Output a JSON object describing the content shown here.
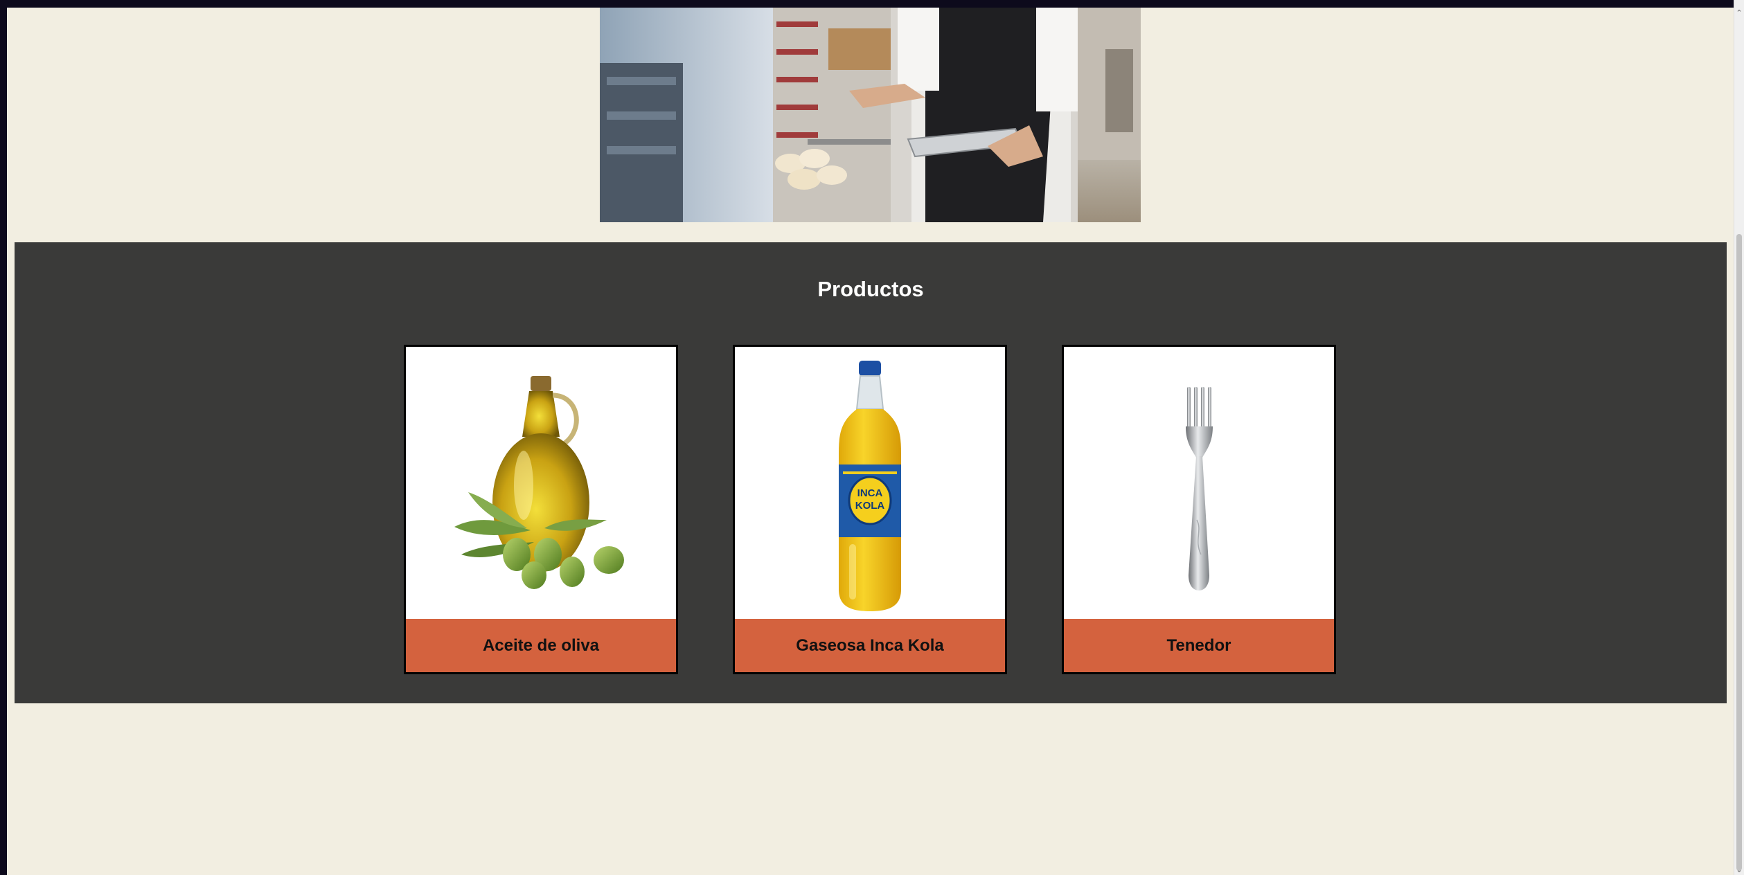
{
  "hero": {
    "alt": "Empleado de panadería con tablet"
  },
  "products_section": {
    "title": "Productos",
    "items": [
      {
        "name": "Aceite de oliva",
        "icon": "olive-oil-image"
      },
      {
        "name": "Gaseosa Inca Kola",
        "icon": "inca-kola-bottle-image",
        "bottle_text": [
          "INCA",
          "KOLA"
        ]
      },
      {
        "name": "Tenedor",
        "icon": "fork-image"
      }
    ]
  },
  "colors": {
    "page_bg": "#f2eee1",
    "section_bg": "#3a3a39",
    "label_bg": "#d4623e",
    "title_color": "#ffffff"
  },
  "scrollbar": {
    "up_arrow": "⌃",
    "down_arrow": "⌄"
  }
}
